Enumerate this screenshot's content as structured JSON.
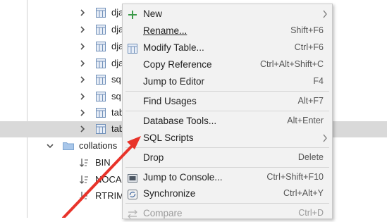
{
  "tree": {
    "rows": [
      {
        "label": "dja",
        "kind": "table"
      },
      {
        "label": "dja",
        "kind": "table"
      },
      {
        "label": "dja",
        "kind": "table"
      },
      {
        "label": "dja",
        "kind": "table"
      },
      {
        "label": "sq",
        "kind": "table"
      },
      {
        "label": "sq",
        "kind": "table"
      },
      {
        "label": "tab",
        "kind": "table"
      },
      {
        "label": "tab",
        "kind": "table",
        "selected": true
      }
    ],
    "collations": {
      "label": "collations"
    },
    "collation_items": [
      {
        "label": "BIN"
      },
      {
        "label": "NOCA"
      },
      {
        "label": "RTRIM"
      }
    ]
  },
  "menu": {
    "items": [
      {
        "label": "New",
        "shortcut": "",
        "icon": "plus-icon",
        "submenu": true
      },
      {
        "label": "Rename...",
        "shortcut": "Shift+F6",
        "icon": ""
      },
      {
        "label": "Modify Table...",
        "shortcut": "Ctrl+F6",
        "icon": "table-icon"
      },
      {
        "label": "Copy Reference",
        "shortcut": "Ctrl+Alt+Shift+C",
        "icon": ""
      },
      {
        "label": "Jump to Editor",
        "shortcut": "F4",
        "icon": ""
      },
      {
        "label": "Find Usages",
        "shortcut": "Alt+F7",
        "icon": ""
      },
      {
        "label": "Database Tools...",
        "shortcut": "Alt+Enter",
        "icon": ""
      },
      {
        "label": "SQL Scripts",
        "shortcut": "",
        "icon": "",
        "submenu": true
      },
      {
        "label": "Drop",
        "shortcut": "Delete",
        "icon": ""
      },
      {
        "label": "Jump to Console...",
        "shortcut": "Ctrl+Shift+F10",
        "icon": "console-icon"
      },
      {
        "label": "Synchronize",
        "shortcut": "Ctrl+Alt+Y",
        "icon": "sync-icon"
      },
      {
        "label": "Compare",
        "shortcut": "Ctrl+D",
        "icon": "compare-icon",
        "disabled": true
      }
    ]
  },
  "colors": {
    "accent_arrow": "#e8332a",
    "selection": "#d9d9d9",
    "menu_bg": "#f2f2f2"
  }
}
